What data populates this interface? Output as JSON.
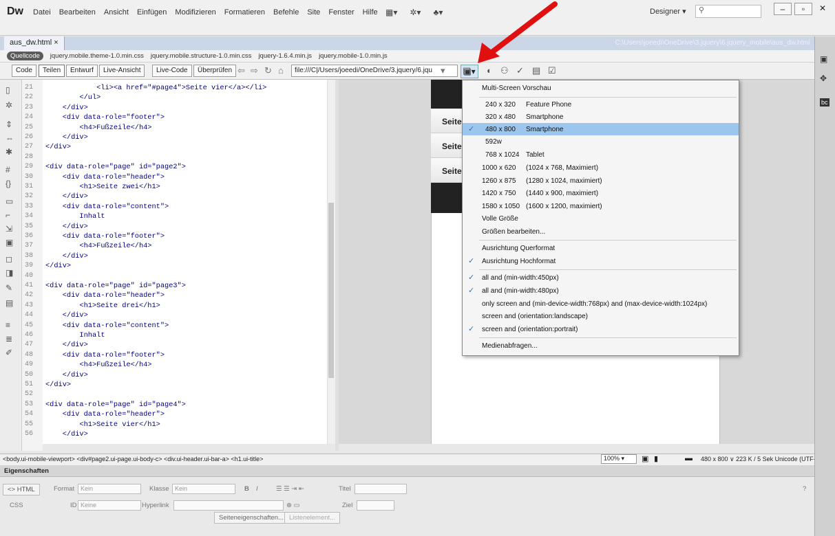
{
  "app": {
    "logo": "Dw",
    "menus": [
      "Datei",
      "Bearbeiten",
      "Ansicht",
      "Einfügen",
      "Modifizieren",
      "Formatieren",
      "Befehle",
      "Site",
      "Fenster",
      "Hilfe"
    ],
    "workspace": "Designer",
    "search_placeholder": ""
  },
  "tab": {
    "name": "aus_dw.html",
    "close": "×",
    "path": "C:\\Users\\joeedi\\OneDrive\\3.jquery\\6.jquery_mobile\\aus_dw.html"
  },
  "files": {
    "source": "Quellcode",
    "related": [
      "jquery.mobile.theme-1.0.min.css",
      "jquery.mobile.structure-1.0.min.css",
      "jquery-1.6.4.min.js",
      "jquery.mobile-1.0.min.js"
    ]
  },
  "toolbar": {
    "code": "Code",
    "split": "Teilen",
    "design": "Entwurf",
    "live": "Live-Ansicht",
    "livecode": "Live-Code",
    "inspect": "Überprüfen",
    "address": "file:///C|/Users/joeedi/OneDrive/3.jquery/6.jqu"
  },
  "code": {
    "lines": [
      {
        "n": "21",
        "t": "            <li><a href=\"#page4\">Seite vier</a></li>"
      },
      {
        "n": "22",
        "t": "        </ul>"
      },
      {
        "n": "23",
        "t": "    </div>"
      },
      {
        "n": "24",
        "t": "    <div data-role=\"footer\">"
      },
      {
        "n": "25",
        "t": "        <h4>Fußzeile</h4>"
      },
      {
        "n": "26",
        "t": "    </div>"
      },
      {
        "n": "27",
        "t": "</div>"
      },
      {
        "n": "28",
        "t": ""
      },
      {
        "n": "29",
        "t": "<div data-role=\"page\" id=\"page2\">"
      },
      {
        "n": "30",
        "t": "    <div data-role=\"header\">"
      },
      {
        "n": "31",
        "t": "        <h1>Seite zwei</h1>"
      },
      {
        "n": "32",
        "t": "    </div>"
      },
      {
        "n": "33",
        "t": "    <div data-role=\"content\">"
      },
      {
        "n": "34",
        "t": "        Inhalt"
      },
      {
        "n": "35",
        "t": "    </div>"
      },
      {
        "n": "36",
        "t": "    <div data-role=\"footer\">"
      },
      {
        "n": "37",
        "t": "        <h4>Fußzeile</h4>"
      },
      {
        "n": "38",
        "t": "    </div>"
      },
      {
        "n": "39",
        "t": "</div>"
      },
      {
        "n": "40",
        "t": ""
      },
      {
        "n": "41",
        "t": "<div data-role=\"page\" id=\"page3\">"
      },
      {
        "n": "42",
        "t": "    <div data-role=\"header\">"
      },
      {
        "n": "43",
        "t": "        <h1>Seite drei</h1>"
      },
      {
        "n": "44",
        "t": "    </div>"
      },
      {
        "n": "45",
        "t": "    <div data-role=\"content\">"
      },
      {
        "n": "46",
        "t": "        Inhalt"
      },
      {
        "n": "47",
        "t": "    </div>"
      },
      {
        "n": "48",
        "t": "    <div data-role=\"footer\">"
      },
      {
        "n": "49",
        "t": "        <h4>Fußzeile</h4>"
      },
      {
        "n": "50",
        "t": "    </div>"
      },
      {
        "n": "51",
        "t": "</div>"
      },
      {
        "n": "52",
        "t": ""
      },
      {
        "n": "53",
        "t": "<div data-role=\"page\" id=\"page4\">"
      },
      {
        "n": "54",
        "t": "    <div data-role=\"header\">"
      },
      {
        "n": "55",
        "t": "        <h1>Seite vier</h1>"
      },
      {
        "n": "56",
        "t": "    </div>"
      }
    ]
  },
  "preview": {
    "items": [
      "Seite",
      "Seite",
      "Seite"
    ]
  },
  "dropdown": {
    "title": "Multi-Screen Vorschau",
    "sizes": [
      {
        "res": "240 x  320",
        "label": "Feature Phone"
      },
      {
        "res": "320 x  480",
        "label": "Smartphone"
      },
      {
        "res": "480 x  800",
        "label": "Smartphone"
      },
      {
        "res": "592w",
        "label": ""
      },
      {
        "res": "768 x 1024",
        "label": "Tablet"
      },
      {
        "res": "1000 x  620",
        "label": "(1024 x 768, Maximiert)"
      },
      {
        "res": "1260 x  875",
        "label": "(1280 x 1024, maximiert)"
      },
      {
        "res": "1420 x  750",
        "label": "(1440 x 900, maximiert)"
      },
      {
        "res": "1580 x 1050",
        "label": "(1600 x 1200, maximiert)"
      }
    ],
    "full": "Volle Größe",
    "edit": "Größen bearbeiten...",
    "landscape": "Ausrichtung Querformat",
    "portrait": "Ausrichtung Hochformat",
    "queries": [
      "all and (min-width:450px)",
      "all and (min-width:480px)",
      "only screen and (min-device-width:768px) and (max-device-width:1024px)",
      "screen and (orientation:landscape)",
      "screen and (orientation:portrait)"
    ],
    "media": "Medienabfragen..."
  },
  "status": {
    "tagpath": "<body.ui-mobile-viewport> <div#page2.ui-page.ui-body-c> <div.ui-header.ui-bar-a> <h1.ui-title>",
    "zoom": "100%",
    "winsize": "480 x 800 ∨  223 K / 5 Sek  Unicode (UTF-8)"
  },
  "props": {
    "title": "Eigenschaften",
    "html": "<> HTML",
    "css": "CSS",
    "format": "Format",
    "format_val": "Kein",
    "klasse": "Klasse",
    "klasse_val": "Kein",
    "id": "ID",
    "id_val": "Keine",
    "link": "Hyperlink",
    "titel": "Titel",
    "ziel": "Ziel",
    "page_props": "Seiteneigenschaften...",
    "list_item": "Listenelement..."
  },
  "colors": {
    "selection": "#9cc6ee",
    "arrow": "#e01010"
  }
}
